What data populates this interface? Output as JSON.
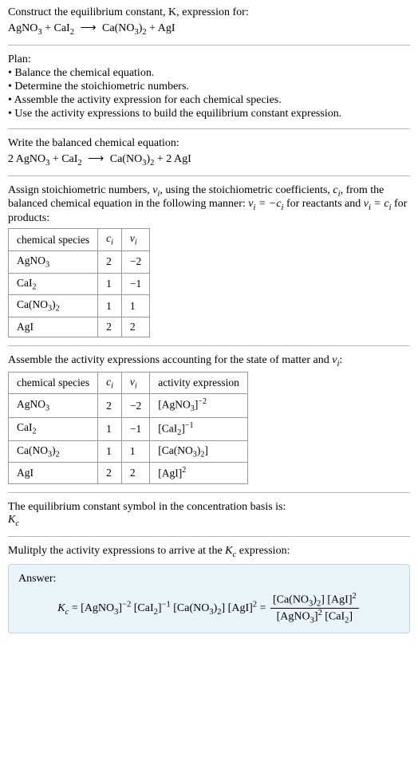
{
  "intro": {
    "line1": "Construct the equilibrium constant, K, expression for:",
    "equation_lhs": "AgNO₃ + CaI₂",
    "equation_rhs": "Ca(NO₃)₂ + AgI"
  },
  "plan": {
    "heading": "Plan:",
    "items": [
      "• Balance the chemical equation.",
      "• Determine the stoichiometric numbers.",
      "• Assemble the activity expression for each chemical species.",
      "• Use the activity expressions to build the equilibrium constant expression."
    ]
  },
  "balanced": {
    "heading": "Write the balanced chemical equation:",
    "lhs": "2 AgNO₃ + CaI₂",
    "rhs": "Ca(NO₃)₂ + 2 AgI"
  },
  "assign": {
    "text_a": "Assign stoichiometric numbers, ",
    "nu": "ν",
    "sub_i": "i",
    "text_b": ", using the stoichiometric coefficients, ",
    "c": "c",
    "text_c": ", from the balanced chemical equation in the following manner: ",
    "rel1_lhs": "ν",
    "rel1_mid": " = −",
    "rel1_rhs": "c",
    "text_d": " for reactants and ",
    "rel2_mid": " = ",
    "text_e": " for products:"
  },
  "table1": {
    "headers": [
      "chemical species",
      "cᵢ",
      "νᵢ"
    ],
    "rows": [
      [
        "AgNO₃",
        "2",
        "−2"
      ],
      [
        "CaI₂",
        "1",
        "−1"
      ],
      [
        "Ca(NO₃)₂",
        "1",
        "1"
      ],
      [
        "AgI",
        "2",
        "2"
      ]
    ]
  },
  "assemble_text": "Assemble the activity expressions accounting for the state of matter and νᵢ:",
  "table2": {
    "headers": [
      "chemical species",
      "cᵢ",
      "νᵢ",
      "activity expression"
    ],
    "rows": [
      {
        "sp": "AgNO₃",
        "c": "2",
        "nu": "−2",
        "act": "[AgNO₃]⁻²"
      },
      {
        "sp": "CaI₂",
        "c": "1",
        "nu": "−1",
        "act": "[CaI₂]⁻¹"
      },
      {
        "sp": "Ca(NO₃)₂",
        "c": "1",
        "nu": "1",
        "act": "[Ca(NO₃)₂]"
      },
      {
        "sp": "AgI",
        "c": "2",
        "nu": "2",
        "act": "[AgI]²"
      }
    ]
  },
  "kc_text": {
    "line1": "The equilibrium constant symbol in the concentration basis is:",
    "symbol": "K",
    "sub": "c"
  },
  "multiply_text": "Mulitply the activity expressions to arrive at the Kc expression:",
  "answer": {
    "label": "Answer:",
    "lhs": "K",
    "lhs_sub": "c",
    "prod": " = [AgNO₃]⁻² [CaI₂]⁻¹ [Ca(NO₃)₂] [AgI]² = ",
    "frac_num": "[Ca(NO₃)₂] [AgI]²",
    "frac_den": "[AgNO₃]² [CaI₂]"
  },
  "chart_data": null
}
